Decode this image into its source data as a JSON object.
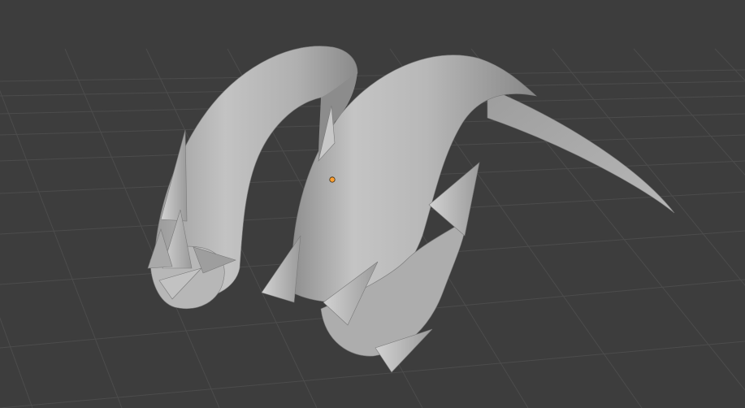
{
  "viewport": {
    "mode": "solid-shading",
    "background_color": "#3d3d3d",
    "grid_color": "#4c4c4c",
    "mesh_base_color": "#bdbdbd",
    "origin_marker_color": "#ffa032"
  },
  "scene": {
    "objects": [
      {
        "name": "left-horn",
        "type": "mesh",
        "selected": false
      },
      {
        "name": "right-horn",
        "type": "mesh",
        "selected": false
      }
    ],
    "spike_count": 10
  }
}
